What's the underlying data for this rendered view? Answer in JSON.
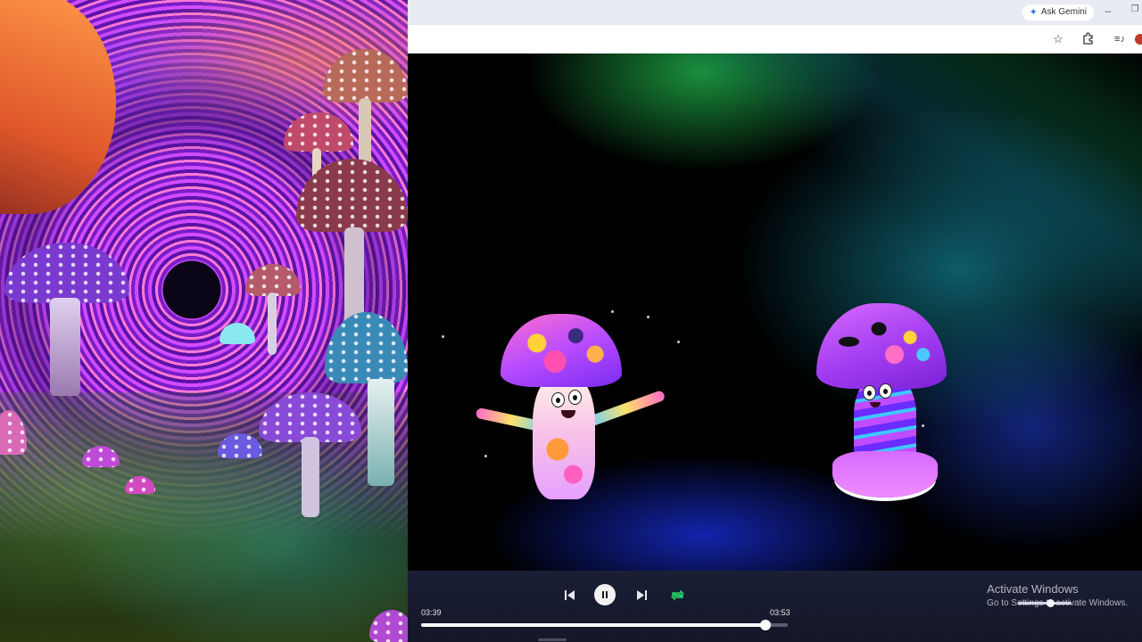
{
  "browser": {
    "ask_gemini_label": "Ask Gemini",
    "icons": {
      "gemini": "sparkle-icon",
      "minimize": "minimize-icon",
      "restore": "restore-icon",
      "bookmark": "star-icon",
      "extensions": "puzzle-icon",
      "media": "media-queue-icon",
      "profile": "avatar"
    }
  },
  "player": {
    "elapsed": "03:39",
    "duration": "03:53",
    "progress_fraction": 0.94,
    "repeat_on": true,
    "playing": true,
    "accent_color": "#2bd46a",
    "icons": {
      "previous": "skip-previous-icon",
      "pause": "pause-icon",
      "next": "skip-next-icon",
      "repeat": "repeat-icon"
    }
  },
  "watermark": {
    "title": "Activate Windows",
    "subtitle": "Go to Settings to activate Windows."
  }
}
